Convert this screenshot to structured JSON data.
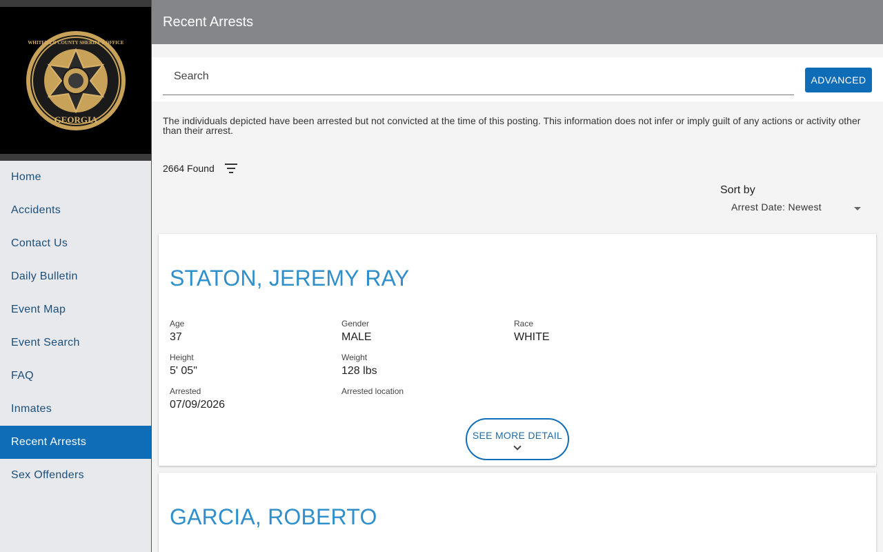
{
  "app": {
    "logo_text": [
      "WHITFIELD COUNTY SHERIFF'S OFFICE",
      "GEORGIA",
      "SHERIFF",
      "WHITFIELD COUNTY"
    ]
  },
  "sidebar": {
    "items": [
      {
        "label": "Home"
      },
      {
        "label": "Accidents"
      },
      {
        "label": "Contact Us"
      },
      {
        "label": "Daily Bulletin"
      },
      {
        "label": "Event Map"
      },
      {
        "label": "Event Search"
      },
      {
        "label": "FAQ"
      },
      {
        "label": "Inmates"
      },
      {
        "label": "Recent Arrests",
        "active": true
      },
      {
        "label": "Sex Offenders"
      }
    ]
  },
  "header": {
    "title": "Recent Arrests"
  },
  "search": {
    "placeholder": "Search",
    "advanced_label": "ADVANCED"
  },
  "disclaimer": "The individuals depicted have been arrested but not convicted at the time of this posting. This information does not infer or imply guilt of any actions or activity other than their arrest.",
  "results": {
    "count_text": "2664 Found",
    "filter_icon": "filter-list-icon"
  },
  "sort": {
    "label": "Sort by",
    "selected": "Arrest Date: Newest"
  },
  "records": [
    {
      "name": "STATON, JEREMY RAY",
      "age_label": "Age",
      "age": "37",
      "gender_label": "Gender",
      "gender": "MALE",
      "race_label": "Race",
      "race": "WHITE",
      "height_label": "Height",
      "height": "5' 05\"",
      "weight_label": "Weight",
      "weight": "128 lbs",
      "arrested_label": "Arrested",
      "arrested": "07/09/2026",
      "location_label": "Arrested location",
      "location": "",
      "more_label": "SEE MORE DETAIL"
    },
    {
      "name": "GARCIA, ROBERTO"
    }
  ],
  "colors": {
    "accent": "#0f6db8",
    "name": "#2f8fcc",
    "header": "#858689"
  }
}
